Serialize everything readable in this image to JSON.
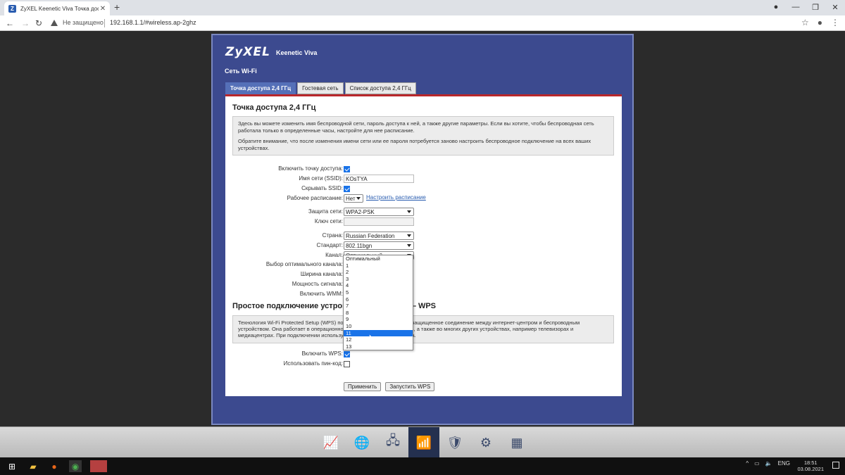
{
  "browser": {
    "tab_title": "ZyXEL Keenetic Viva Точка досту",
    "tab_favicon": "Z",
    "new_tab": "+",
    "security_label": "Не защищено",
    "url": "192.168.1.1/#wireless.ap-2ghz"
  },
  "router": {
    "logo": "ZyXEL",
    "model": "Keenetic Viva",
    "section": "Сеть Wi-Fi",
    "tabs": [
      {
        "label": "Точка доступа 2,4 ГГц"
      },
      {
        "label": "Гостевая сеть"
      },
      {
        "label": "Список доступа 2,4 ГГц"
      }
    ],
    "panel_title": "Точка доступа 2,4 ГГц",
    "info_p1": "Здесь вы можете изменить имя беспроводной сети, пароль доступа к ней, а также другие параметры. Если вы хотите, чтобы беспроводная сеть работала только в определенные часы, настройте для нее расписание.",
    "info_p2": "Обратите внимание, что после изменения имени сети или ее пароля потребуется заново настроить беспроводное подключение на всех ваших устройствах.",
    "fields": {
      "enable_ap": "Включить точку доступа:",
      "ssid_label": "Имя сети (SSID):",
      "ssid_value": "KOsTYA",
      "hide_ssid": "Скрывать SSID:",
      "schedule_label": "Рабочее расписание:",
      "schedule_value": "Нет",
      "schedule_link": "Настроить расписание",
      "security_label": "Защита сети:",
      "security_value": "WPA2-PSK",
      "key_label": "Ключ сети:",
      "country_label": "Страна:",
      "country_value": "Russian Federation",
      "standard_label": "Стандарт:",
      "standard_value": "802.11bgn",
      "channel_label": "Канал:",
      "channel_value": "Оптимальный",
      "opt_channel_label": "Выбор оптимального канала:",
      "width_label": "Ширина канала:",
      "power_label": "Мощность сигнала:",
      "wmm_label": "Включить WMM:"
    },
    "wps_title": "Простое подключение устройств к Wi-Fi сети — WPS",
    "wps_info": "Технология Wi-Fi Protected Setup (WPS) позволяет быстро установить защищенное соединение между интернет-центром и беспроводным устройством. Она работает в операционной системе Microsoft Windows, а также во многих других устройствах, например телевизорах и медиацентрах. При подключении используйте PIN-код интернет-центра.",
    "wps_enable": "Включить WPS:",
    "wps_pin": "Использовать пин-код:",
    "apply_button": "Применить",
    "start_wps_button": "Запустить WPS",
    "channel_options": [
      "Оптимальный",
      "1",
      "2",
      "3",
      "4",
      "5",
      "6",
      "7",
      "8",
      "9",
      "10",
      "11",
      "12",
      "13"
    ],
    "channel_highlighted": "11"
  },
  "taskbar": {
    "lang": "ENG",
    "time": "18:51",
    "date": "03.08.2021"
  }
}
